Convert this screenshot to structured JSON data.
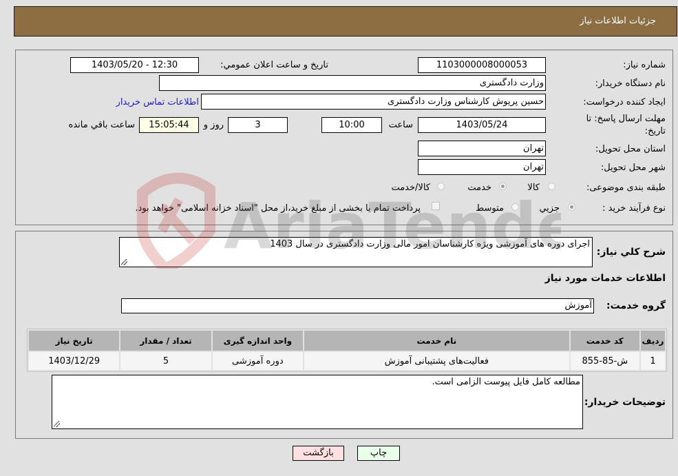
{
  "header": {
    "title": "جزئیات اطلاعات نیاز"
  },
  "details": {
    "need_number": {
      "label": "شماره نیاز:",
      "value": "1103000008000053"
    },
    "announce_datetime": {
      "label": "تاریخ و ساعت اعلان عمومي:",
      "value": "1403/05/20 - 12:30"
    },
    "buyer_org": {
      "label": "نام دستگاه خریدار:",
      "value": "وزارت دادگستری"
    },
    "requester": {
      "label": "ایجاد کننده درخواست:",
      "value": "حسین پریوش کارشناس وزارت دادگستری"
    },
    "buyer_contact_link": "اطلاعات تماس خریدار",
    "deadline": {
      "label_line1": "مهلت ارسال پاسخ: تا",
      "label_line2": "تاریخ:",
      "date": "1403/05/24",
      "time_label": "ساعت",
      "time": "10:00",
      "days": "3",
      "days_label": "روز و",
      "remaining": "15:05:44",
      "remaining_label": "ساعت باقي مانده"
    },
    "province": {
      "label": "استان محل تحویل:",
      "value": "تهران"
    },
    "city": {
      "label": "شهر محل تحویل:",
      "value": "تهران"
    },
    "category": {
      "label": "طبقه بندی موضوعی:",
      "options": [
        "کالا",
        "خدمت",
        "کالا/خدمت"
      ],
      "selected": "خدمت"
    },
    "purchase_type": {
      "label": "نوع فرآیند خرید :",
      "options": [
        "جزيي",
        "متوسط"
      ],
      "selected": "جزيي",
      "treasury_note": "پرداخت تمام یا بخشی از مبلغ خرید،از محل \"اسناد خزانه اسلامی\" خواهد بود.",
      "treasury_checked": false
    }
  },
  "description": {
    "label": "شرح کلي نیاز:",
    "value": "اجرای دوره های آموزشی ویژه کارشناسان امور مالی وزارت دادگستری در سال 1403"
  },
  "services": {
    "section_title": "اطلاعات خدمات مورد نیاز",
    "group_label": "گروه خدمت:",
    "group_value": "آموزش",
    "table": {
      "headers": [
        "ردیف",
        "کد خدمت",
        "نام خدمت",
        "واحد اندازه گیری",
        "تعداد / مقدار",
        "تاریخ نیاز"
      ],
      "rows": [
        [
          "1",
          "ش-85-855",
          "فعالیت‌های پشتیبانی آموزش",
          "دوره آموزشی",
          "5",
          "1403/12/29"
        ]
      ]
    }
  },
  "buyer_notes": {
    "label": "توضیحات خریدار:",
    "value": "مطالعه کامل فایل پیوست الزامی است."
  },
  "buttons": {
    "print": "چاپ",
    "back": "بازگشت"
  },
  "colors": {
    "header_bg": "#8d6e43",
    "print_bg": "#eaffea",
    "back_bg": "#ffe0e0",
    "link": "#1a1acc"
  },
  "watermark": {
    "text": "AriaTender.neT"
  }
}
